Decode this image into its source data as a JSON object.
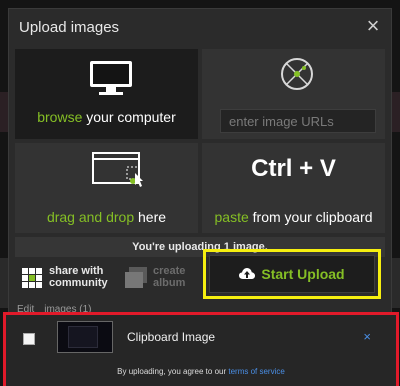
{
  "dialog": {
    "title": "Upload images",
    "close_label": "×"
  },
  "sources": {
    "browse": {
      "accent": "browse",
      "rest": " your computer"
    },
    "url": {
      "placeholder": "enter image URLs"
    },
    "drag": {
      "accent": "drag and drop",
      "rest": " here"
    },
    "paste": {
      "shortcut": "Ctrl + V",
      "accent": "paste",
      "rest": " from your clipboard"
    }
  },
  "status": {
    "text": "You're uploading 1 image."
  },
  "actions": {
    "share_line1": "share with",
    "share_line2": "community",
    "album_line1": "create",
    "album_line2": "album",
    "start_upload": "Start Upload"
  },
  "list_header": {
    "edit": "Edit",
    "images": "images (1)"
  },
  "queue": {
    "items": [
      {
        "name": "Clipboard Image",
        "remove": "×"
      }
    ],
    "agree_prefix": "By uploading, you agree to our ",
    "agree_link": "terms of service"
  },
  "colors": {
    "accent_green": "#85bf25",
    "highlight_yellow": "#f6ef10",
    "highlight_red": "#e11a2a",
    "link_blue": "#4a8fe6"
  }
}
